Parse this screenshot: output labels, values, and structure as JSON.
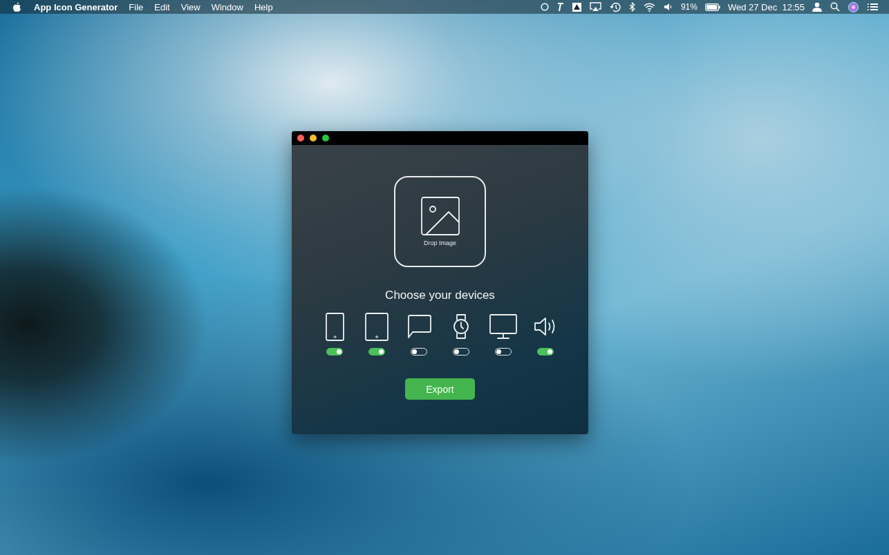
{
  "menu_bar": {
    "app_name": "App Icon Generator",
    "menus": [
      "File",
      "Edit",
      "View",
      "Window",
      "Help"
    ],
    "battery": "91%",
    "clock": "Wed 27 Dec  12:55"
  },
  "window": {
    "drop_label": "Drop Image",
    "heading": "Choose your devices",
    "devices": [
      {
        "kind": "phone",
        "on": true
      },
      {
        "kind": "tablet",
        "on": true
      },
      {
        "kind": "message",
        "on": false
      },
      {
        "kind": "watch",
        "on": false
      },
      {
        "kind": "desktop",
        "on": false
      },
      {
        "kind": "speaker",
        "on": true
      }
    ],
    "export_button": "Export"
  }
}
